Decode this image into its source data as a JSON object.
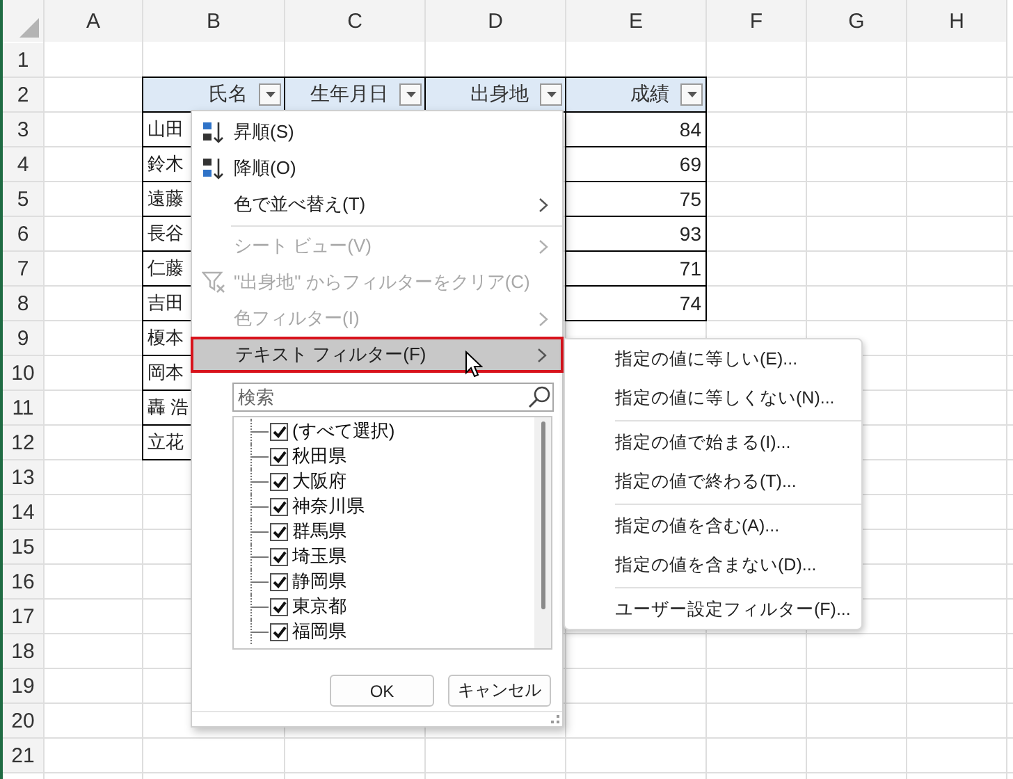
{
  "column_headers": [
    "A",
    "B",
    "C",
    "D",
    "E",
    "F",
    "G",
    "H"
  ],
  "row_headers": [
    "1",
    "2",
    "3",
    "4",
    "5",
    "6",
    "7",
    "8",
    "9",
    "10",
    "11",
    "12",
    "13",
    "14",
    "15",
    "16",
    "17",
    "18",
    "19",
    "20",
    "21"
  ],
  "table": {
    "headers": [
      "氏名",
      "生年月日",
      "出身地",
      "成績"
    ],
    "rows": [
      {
        "name": "山田",
        "score": "84"
      },
      {
        "name": "鈴木",
        "score": "69"
      },
      {
        "name": "遠藤",
        "score": "75"
      },
      {
        "name": "長谷",
        "score": "93"
      },
      {
        "name": "仁藤",
        "score": "71"
      },
      {
        "name": "吉田",
        "score": "74"
      },
      {
        "name": "榎本"
      },
      {
        "name": "岡本"
      },
      {
        "name": "轟 浩"
      },
      {
        "name": "立花"
      }
    ]
  },
  "filter_menu": {
    "items": [
      {
        "kind": "sort-ascending",
        "label": "昇順(S)",
        "disabled": false,
        "selected": false
      },
      {
        "kind": "sort-descending",
        "label": "降順(O)",
        "disabled": false,
        "selected": false
      },
      {
        "kind": "submenu",
        "label": "色で並べ替え(T)",
        "disabled": false,
        "selected": false
      },
      {
        "kind": "separator"
      },
      {
        "kind": "submenu",
        "label": "シート ビュー(V)",
        "disabled": true,
        "selected": false
      },
      {
        "kind": "clear-filter",
        "label": "\"出身地\" からフィルターをクリア(C)",
        "disabled": true,
        "selected": false
      },
      {
        "kind": "submenu",
        "label": "色フィルター(I)",
        "disabled": true,
        "selected": false
      },
      {
        "kind": "submenu",
        "label": "テキスト フィルター(F)",
        "disabled": false,
        "selected": true
      }
    ],
    "search": {
      "placeholder": "検索"
    },
    "values": [
      {
        "label": "(すべて選択)",
        "checked": true
      },
      {
        "label": "秋田県",
        "checked": true
      },
      {
        "label": "大阪府",
        "checked": true
      },
      {
        "label": "神奈川県",
        "checked": true
      },
      {
        "label": "群馬県",
        "checked": true
      },
      {
        "label": "埼玉県",
        "checked": true
      },
      {
        "label": "静岡県",
        "checked": true
      },
      {
        "label": "東京都",
        "checked": true
      },
      {
        "label": "福岡県",
        "checked": true
      }
    ],
    "buttons": [
      "OK",
      "キャンセル"
    ]
  },
  "text_filter_submenu": {
    "groups": [
      [
        "指定の値に等しい(E)...",
        "指定の値に等しくない(N)..."
      ],
      [
        "指定の値で始まる(I)...",
        "指定の値で終わる(T)..."
      ],
      [
        "指定の値を含む(A)...",
        "指定の値を含まない(D)..."
      ],
      [
        "ユーザー設定フィルター(F)..."
      ]
    ]
  }
}
